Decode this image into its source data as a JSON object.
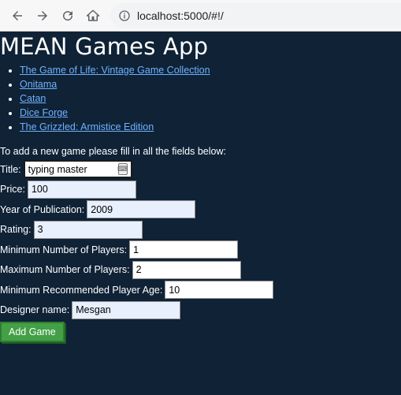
{
  "browser": {
    "url": "localhost:5000/#!/"
  },
  "header": {
    "title": "MEAN Games App"
  },
  "games": [
    {
      "label": "The Game of Life: Vintage Game Collection"
    },
    {
      "label": "Onitama"
    },
    {
      "label": "Catan"
    },
    {
      "label": "Dice Forge"
    },
    {
      "label": "The Grizzled: Armistice Edition"
    }
  ],
  "form": {
    "intro": "To add a new game please fill in all the fields below:",
    "title_label": "Title:",
    "title_value": "typing master",
    "price_label": "Price:",
    "price_value": "100",
    "year_label": "Year of Publication:",
    "year_value": "2009",
    "rating_label": "Rating:",
    "rating_value": "3",
    "min_players_label": "Minimum Number of Players:",
    "min_players_value": "1",
    "max_players_label": "Maximum Number of Players:",
    "max_players_value": "2",
    "min_age_label": "Minimum Recommended Player Age:",
    "min_age_value": "10",
    "designer_label": "Designer name:",
    "designer_value": "Mesgan",
    "submit_label": "Add Game"
  },
  "colors": {
    "background": "#0f2236",
    "link": "#6eb2ff",
    "button": "#43a047"
  }
}
